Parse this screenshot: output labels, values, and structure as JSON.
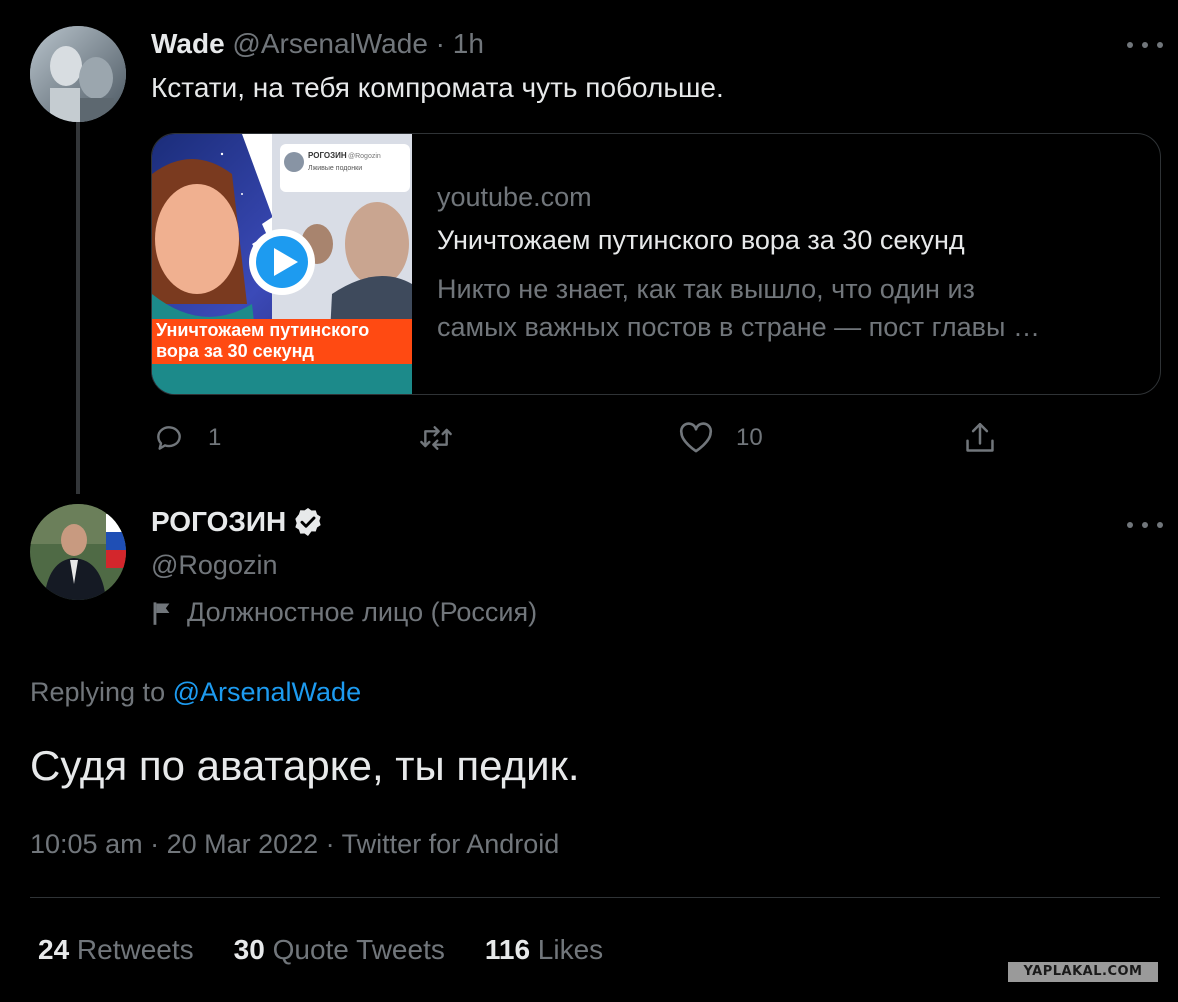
{
  "reply_tweet": {
    "author_name": "Wade",
    "handle": "@ArsenalWade",
    "time": "· 1h",
    "text": "Кстати, на тебя компромата чуть побольше.",
    "card": {
      "domain": "youtube.com",
      "title": "Уничтожаем путинского вора за 30 секунд",
      "description_line1": "Никто не знает, как так вышло, что один из",
      "description_line2": "самых важных постов в стране — пост главы …",
      "thumb_caption_line1": "Уничтожаем путинского",
      "thumb_caption_line2": "вора за 30 секунд",
      "thumb_small_name": "РОГОЗИН",
      "thumb_small_handle": "@Rogozin",
      "thumb_small_sub": "Лживые подонки"
    },
    "actions": {
      "reply_count": "1",
      "like_count": "10"
    }
  },
  "main_tweet": {
    "author_name": "РОГОЗИН",
    "handle": "@Rogozin",
    "label": "Должностное лицо (Россия)",
    "replying_prefix": "Replying to ",
    "replying_to": "@ArsenalWade",
    "text": "Судя по аватарке, ты педик.",
    "meta": "10:05 am · 20 Mar 2022 · Twitter for Android"
  },
  "stats": [
    {
      "count": "24",
      "label": " Retweets"
    },
    {
      "count": "30",
      "label": " Quote Tweets"
    },
    {
      "count": "116",
      "label": " Likes"
    }
  ],
  "watermark": "YAPLAKAL.COM",
  "colors": {
    "background": "#000000",
    "text": "#e7e9ea",
    "muted": "#71767b",
    "link": "#1d9bf0",
    "border": "#2f3336"
  }
}
